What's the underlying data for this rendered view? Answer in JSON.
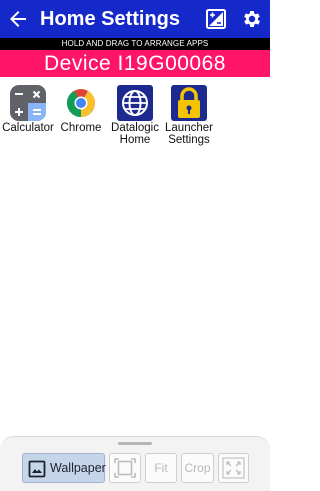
{
  "header": {
    "title": "Home Settings",
    "back_icon": "arrow-back-icon",
    "wallpaper_icon": "wallpaper-icon",
    "settings_icon": "gear-icon"
  },
  "hint": "HOLD AND DRAG TO ARRANGE APPS",
  "device_banner": "Device I19G00068",
  "apps": [
    {
      "label": "Calculator",
      "icon": "calculator-icon"
    },
    {
      "label": "Chrome",
      "icon": "chrome-icon"
    },
    {
      "label": "Datalogic Home",
      "icon": "globe-icon"
    },
    {
      "label": "Launcher Settings",
      "icon": "lock-icon"
    }
  ],
  "toolbar": {
    "wallpaper_label": "Wallpaper",
    "fill_icon": "fill-frame-icon",
    "fit_label": "Fit",
    "crop_label": "Crop",
    "expand_icon": "expand-icon"
  },
  "colors": {
    "appbar": "#1528c9",
    "banner": "#ff1567",
    "hint_bar": "#000000"
  }
}
